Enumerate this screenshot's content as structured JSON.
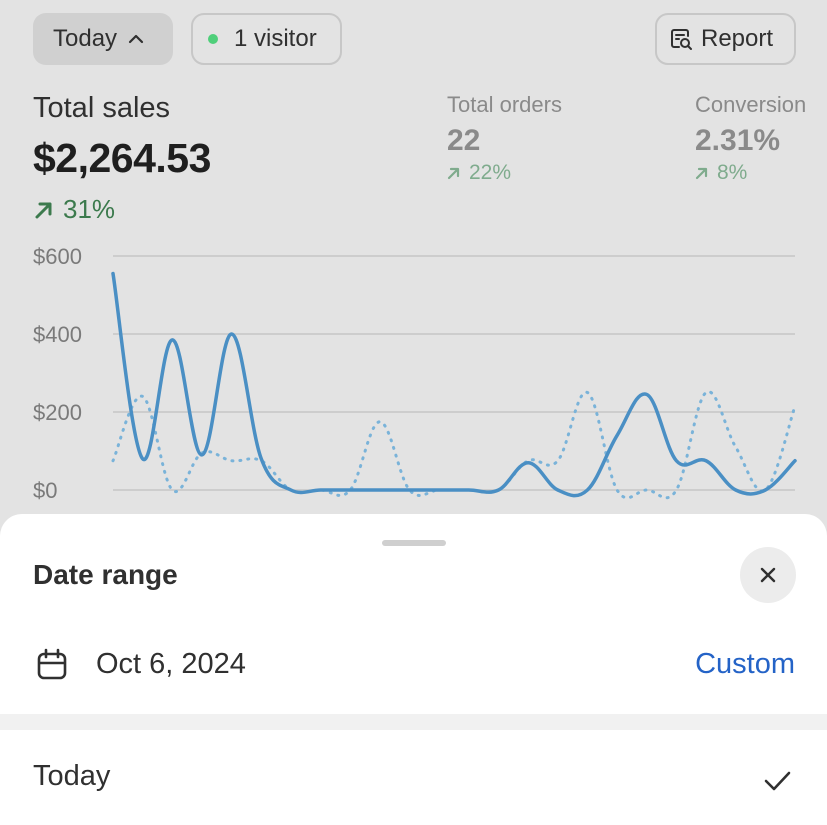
{
  "toolbar": {
    "date_filter_label": "Today",
    "visitors_label": "1 visitor",
    "report_label": "Report",
    "live_dot_color": "#4fcf7a"
  },
  "metrics": {
    "total_sales": {
      "label": "Total sales",
      "value": "$2,264.53",
      "change": "31%",
      "trend": "up"
    },
    "total_orders": {
      "label": "Total orders",
      "value": "22",
      "change": "22%",
      "trend": "up"
    },
    "conversion": {
      "label": "Conversion",
      "value": "2.31%",
      "change": "8%",
      "trend": "up"
    }
  },
  "chart_data": {
    "type": "line",
    "ylim": [
      0,
      600
    ],
    "ytick_labels": [
      "$600",
      "$400",
      "$200",
      "$0"
    ],
    "grid": true,
    "series": [
      {
        "style": "solid",
        "color": "#4a8fc4",
        "values": [
          555,
          80,
          385,
          90,
          400,
          80,
          0,
          0,
          0,
          0,
          0,
          0,
          0,
          0,
          70,
          0,
          0,
          140,
          245,
          75,
          75,
          0,
          0,
          75
        ]
      },
      {
        "style": "dotted",
        "color": "#7ab3d9",
        "values": [
          75,
          240,
          0,
          95,
          75,
          75,
          0,
          0,
          0,
          175,
          0,
          0,
          0,
          0,
          75,
          75,
          250,
          0,
          0,
          0,
          250,
          110,
          0,
          215
        ]
      }
    ]
  },
  "sheet": {
    "title": "Date range",
    "date_value": "Oct 6, 2024",
    "custom_label": "Custom",
    "options": [
      {
        "label": "Today",
        "selected": true
      }
    ]
  }
}
